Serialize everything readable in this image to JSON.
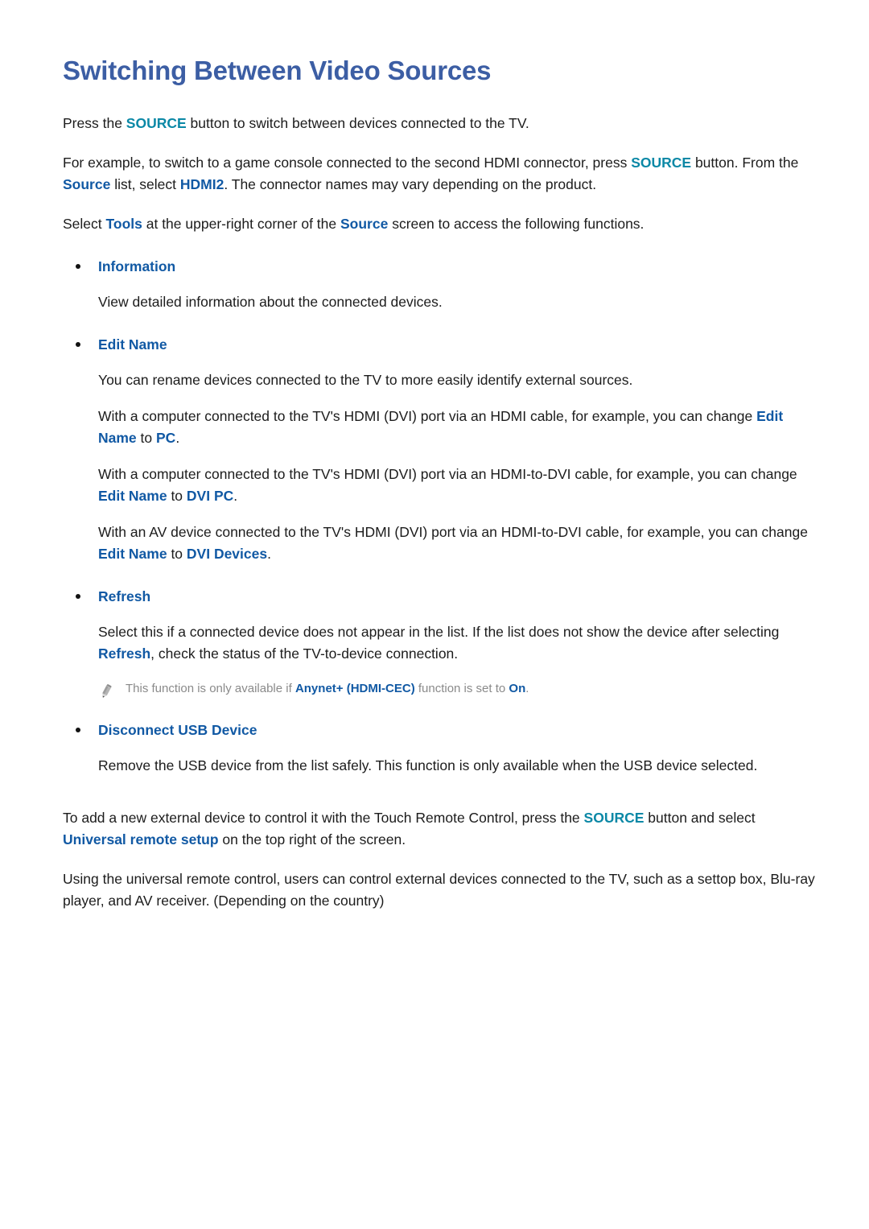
{
  "document": {
    "title": "Switching Between Video Sources",
    "colors": {
      "title": "#3c5ea4",
      "teal_term": "#0b88a6",
      "blue_term": "#1159a4",
      "body_text": "#1c1c1c",
      "note_text": "#8a8a8a",
      "background": "#ffffff"
    },
    "intro": {
      "p1": {
        "a": "Press the ",
        "term1": "SOURCE",
        "b": " button to switch between devices connected to the TV."
      },
      "p2": {
        "a": "For example, to switch to a game console connected to the second HDMI connector, press ",
        "term1": "SOURCE",
        "b": " button. From the ",
        "term2": "Source",
        "c": " list, select ",
        "term3": "HDMI2",
        "d": ". The connector names may vary depending on the product."
      },
      "p3": {
        "a": "Select ",
        "term1": "Tools",
        "b": " at the upper-right corner of the ",
        "term2": "Source",
        "c": " screen to access the following functions."
      }
    },
    "bullets": [
      {
        "heading": "Information",
        "paragraphs": [
          {
            "text": "View detailed information about the connected devices."
          }
        ]
      },
      {
        "heading": "Edit Name",
        "paragraphs": [
          {
            "text": "You can rename devices connected to the TV to more easily identify external sources."
          },
          {
            "a": "With a computer connected to the TV's HDMI (DVI) port via an HDMI cable, for example, you can change ",
            "term1": "Edit Name",
            "b": " to ",
            "term2": "PC",
            "c": "."
          },
          {
            "a": "With a computer connected to the TV's HDMI (DVI) port via an HDMI-to-DVI cable, for example, you can change ",
            "term1": "Edit Name",
            "b": " to ",
            "term2": "DVI PC",
            "c": "."
          },
          {
            "a": "With an AV device connected to the TV's HDMI (DVI) port via an HDMI-to-DVI cable, for example, you can change ",
            "term1": "Edit Name",
            "b": " to ",
            "term2": "DVI Devices",
            "c": "."
          }
        ]
      },
      {
        "heading": "Refresh",
        "paragraphs": [
          {
            "a": "Select this if a connected device does not appear in the list. If the list does not show the device after selecting ",
            "term1": "Refresh",
            "b": ", check the status of the TV-to-device connection."
          }
        ],
        "note": {
          "icon": "pencil-icon",
          "a": "This function is only available if ",
          "term1": "Anynet+ (HDMI-CEC)",
          "b": " function is set to ",
          "term2": "On",
          "c": "."
        }
      },
      {
        "heading": "Disconnect USB Device",
        "paragraphs": [
          {
            "text": "Remove the USB device from the list safely. This function is only available when the USB device selected."
          }
        ]
      }
    ],
    "outro": {
      "p1": {
        "a": "To add a new external device to control it with the Touch Remote Control, press the ",
        "term1": "SOURCE",
        "b": " button and select ",
        "term2": "Universal remote setup",
        "c": " on the top right of the screen."
      },
      "p2": {
        "text": "Using the universal remote control, users can control external devices connected to the TV, such as a settop box, Blu-ray player, and AV receiver. (Depending on the country)"
      }
    }
  }
}
